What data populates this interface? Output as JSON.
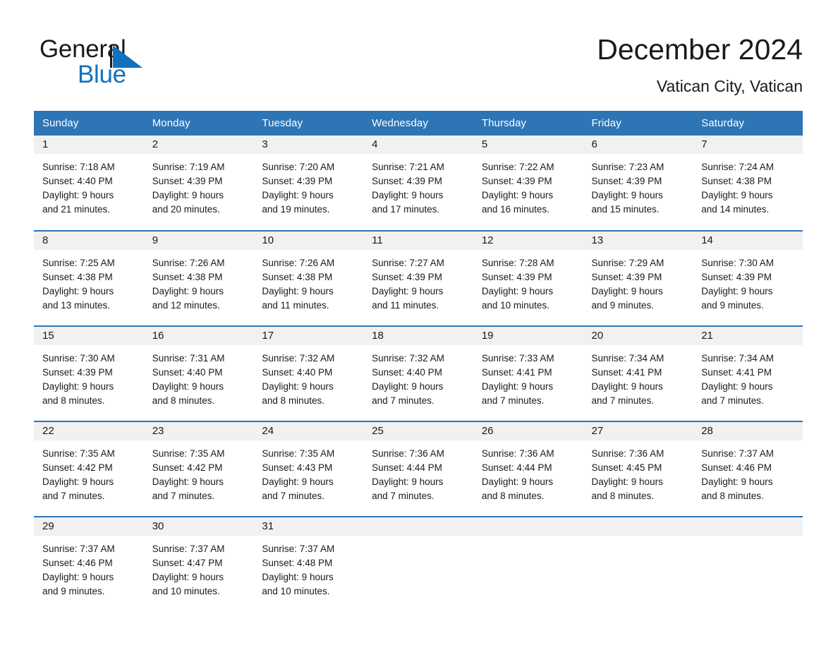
{
  "brand": {
    "name_part1": "General",
    "name_part2": "Blue",
    "triangle_icon": "triangle-icon",
    "accent_color": "#1271bd"
  },
  "header": {
    "title": "December 2024",
    "subtitle": "Vatican City, Vatican",
    "header_bg_color": "#2e75b6",
    "daynum_bg_color": "#f1f1f1"
  },
  "weekdays": [
    "Sunday",
    "Monday",
    "Tuesday",
    "Wednesday",
    "Thursday",
    "Friday",
    "Saturday"
  ],
  "weeks": [
    [
      {
        "day": "1",
        "sunrise": "Sunrise: 7:18 AM",
        "sunset": "Sunset: 4:40 PM",
        "daylight_line1": "Daylight: 9 hours",
        "daylight_line2": "and 21 minutes."
      },
      {
        "day": "2",
        "sunrise": "Sunrise: 7:19 AM",
        "sunset": "Sunset: 4:39 PM",
        "daylight_line1": "Daylight: 9 hours",
        "daylight_line2": "and 20 minutes."
      },
      {
        "day": "3",
        "sunrise": "Sunrise: 7:20 AM",
        "sunset": "Sunset: 4:39 PM",
        "daylight_line1": "Daylight: 9 hours",
        "daylight_line2": "and 19 minutes."
      },
      {
        "day": "4",
        "sunrise": "Sunrise: 7:21 AM",
        "sunset": "Sunset: 4:39 PM",
        "daylight_line1": "Daylight: 9 hours",
        "daylight_line2": "and 17 minutes."
      },
      {
        "day": "5",
        "sunrise": "Sunrise: 7:22 AM",
        "sunset": "Sunset: 4:39 PM",
        "daylight_line1": "Daylight: 9 hours",
        "daylight_line2": "and 16 minutes."
      },
      {
        "day": "6",
        "sunrise": "Sunrise: 7:23 AM",
        "sunset": "Sunset: 4:39 PM",
        "daylight_line1": "Daylight: 9 hours",
        "daylight_line2": "and 15 minutes."
      },
      {
        "day": "7",
        "sunrise": "Sunrise: 7:24 AM",
        "sunset": "Sunset: 4:38 PM",
        "daylight_line1": "Daylight: 9 hours",
        "daylight_line2": "and 14 minutes."
      }
    ],
    [
      {
        "day": "8",
        "sunrise": "Sunrise: 7:25 AM",
        "sunset": "Sunset: 4:38 PM",
        "daylight_line1": "Daylight: 9 hours",
        "daylight_line2": "and 13 minutes."
      },
      {
        "day": "9",
        "sunrise": "Sunrise: 7:26 AM",
        "sunset": "Sunset: 4:38 PM",
        "daylight_line1": "Daylight: 9 hours",
        "daylight_line2": "and 12 minutes."
      },
      {
        "day": "10",
        "sunrise": "Sunrise: 7:26 AM",
        "sunset": "Sunset: 4:38 PM",
        "daylight_line1": "Daylight: 9 hours",
        "daylight_line2": "and 11 minutes."
      },
      {
        "day": "11",
        "sunrise": "Sunrise: 7:27 AM",
        "sunset": "Sunset: 4:39 PM",
        "daylight_line1": "Daylight: 9 hours",
        "daylight_line2": "and 11 minutes."
      },
      {
        "day": "12",
        "sunrise": "Sunrise: 7:28 AM",
        "sunset": "Sunset: 4:39 PM",
        "daylight_line1": "Daylight: 9 hours",
        "daylight_line2": "and 10 minutes."
      },
      {
        "day": "13",
        "sunrise": "Sunrise: 7:29 AM",
        "sunset": "Sunset: 4:39 PM",
        "daylight_line1": "Daylight: 9 hours",
        "daylight_line2": "and 9 minutes."
      },
      {
        "day": "14",
        "sunrise": "Sunrise: 7:30 AM",
        "sunset": "Sunset: 4:39 PM",
        "daylight_line1": "Daylight: 9 hours",
        "daylight_line2": "and 9 minutes."
      }
    ],
    [
      {
        "day": "15",
        "sunrise": "Sunrise: 7:30 AM",
        "sunset": "Sunset: 4:39 PM",
        "daylight_line1": "Daylight: 9 hours",
        "daylight_line2": "and 8 minutes."
      },
      {
        "day": "16",
        "sunrise": "Sunrise: 7:31 AM",
        "sunset": "Sunset: 4:40 PM",
        "daylight_line1": "Daylight: 9 hours",
        "daylight_line2": "and 8 minutes."
      },
      {
        "day": "17",
        "sunrise": "Sunrise: 7:32 AM",
        "sunset": "Sunset: 4:40 PM",
        "daylight_line1": "Daylight: 9 hours",
        "daylight_line2": "and 8 minutes."
      },
      {
        "day": "18",
        "sunrise": "Sunrise: 7:32 AM",
        "sunset": "Sunset: 4:40 PM",
        "daylight_line1": "Daylight: 9 hours",
        "daylight_line2": "and 7 minutes."
      },
      {
        "day": "19",
        "sunrise": "Sunrise: 7:33 AM",
        "sunset": "Sunset: 4:41 PM",
        "daylight_line1": "Daylight: 9 hours",
        "daylight_line2": "and 7 minutes."
      },
      {
        "day": "20",
        "sunrise": "Sunrise: 7:34 AM",
        "sunset": "Sunset: 4:41 PM",
        "daylight_line1": "Daylight: 9 hours",
        "daylight_line2": "and 7 minutes."
      },
      {
        "day": "21",
        "sunrise": "Sunrise: 7:34 AM",
        "sunset": "Sunset: 4:41 PM",
        "daylight_line1": "Daylight: 9 hours",
        "daylight_line2": "and 7 minutes."
      }
    ],
    [
      {
        "day": "22",
        "sunrise": "Sunrise: 7:35 AM",
        "sunset": "Sunset: 4:42 PM",
        "daylight_line1": "Daylight: 9 hours",
        "daylight_line2": "and 7 minutes."
      },
      {
        "day": "23",
        "sunrise": "Sunrise: 7:35 AM",
        "sunset": "Sunset: 4:42 PM",
        "daylight_line1": "Daylight: 9 hours",
        "daylight_line2": "and 7 minutes."
      },
      {
        "day": "24",
        "sunrise": "Sunrise: 7:35 AM",
        "sunset": "Sunset: 4:43 PM",
        "daylight_line1": "Daylight: 9 hours",
        "daylight_line2": "and 7 minutes."
      },
      {
        "day": "25",
        "sunrise": "Sunrise: 7:36 AM",
        "sunset": "Sunset: 4:44 PM",
        "daylight_line1": "Daylight: 9 hours",
        "daylight_line2": "and 7 minutes."
      },
      {
        "day": "26",
        "sunrise": "Sunrise: 7:36 AM",
        "sunset": "Sunset: 4:44 PM",
        "daylight_line1": "Daylight: 9 hours",
        "daylight_line2": "and 8 minutes."
      },
      {
        "day": "27",
        "sunrise": "Sunrise: 7:36 AM",
        "sunset": "Sunset: 4:45 PM",
        "daylight_line1": "Daylight: 9 hours",
        "daylight_line2": "and 8 minutes."
      },
      {
        "day": "28",
        "sunrise": "Sunrise: 7:37 AM",
        "sunset": "Sunset: 4:46 PM",
        "daylight_line1": "Daylight: 9 hours",
        "daylight_line2": "and 8 minutes."
      }
    ],
    [
      {
        "day": "29",
        "sunrise": "Sunrise: 7:37 AM",
        "sunset": "Sunset: 4:46 PM",
        "daylight_line1": "Daylight: 9 hours",
        "daylight_line2": "and 9 minutes."
      },
      {
        "day": "30",
        "sunrise": "Sunrise: 7:37 AM",
        "sunset": "Sunset: 4:47 PM",
        "daylight_line1": "Daylight: 9 hours",
        "daylight_line2": "and 10 minutes."
      },
      {
        "day": "31",
        "sunrise": "Sunrise: 7:37 AM",
        "sunset": "Sunset: 4:48 PM",
        "daylight_line1": "Daylight: 9 hours",
        "daylight_line2": "and 10 minutes."
      },
      {
        "day": "",
        "sunrise": "",
        "sunset": "",
        "daylight_line1": "",
        "daylight_line2": ""
      },
      {
        "day": "",
        "sunrise": "",
        "sunset": "",
        "daylight_line1": "",
        "daylight_line2": ""
      },
      {
        "day": "",
        "sunrise": "",
        "sunset": "",
        "daylight_line1": "",
        "daylight_line2": ""
      },
      {
        "day": "",
        "sunrise": "",
        "sunset": "",
        "daylight_line1": "",
        "daylight_line2": ""
      }
    ]
  ]
}
